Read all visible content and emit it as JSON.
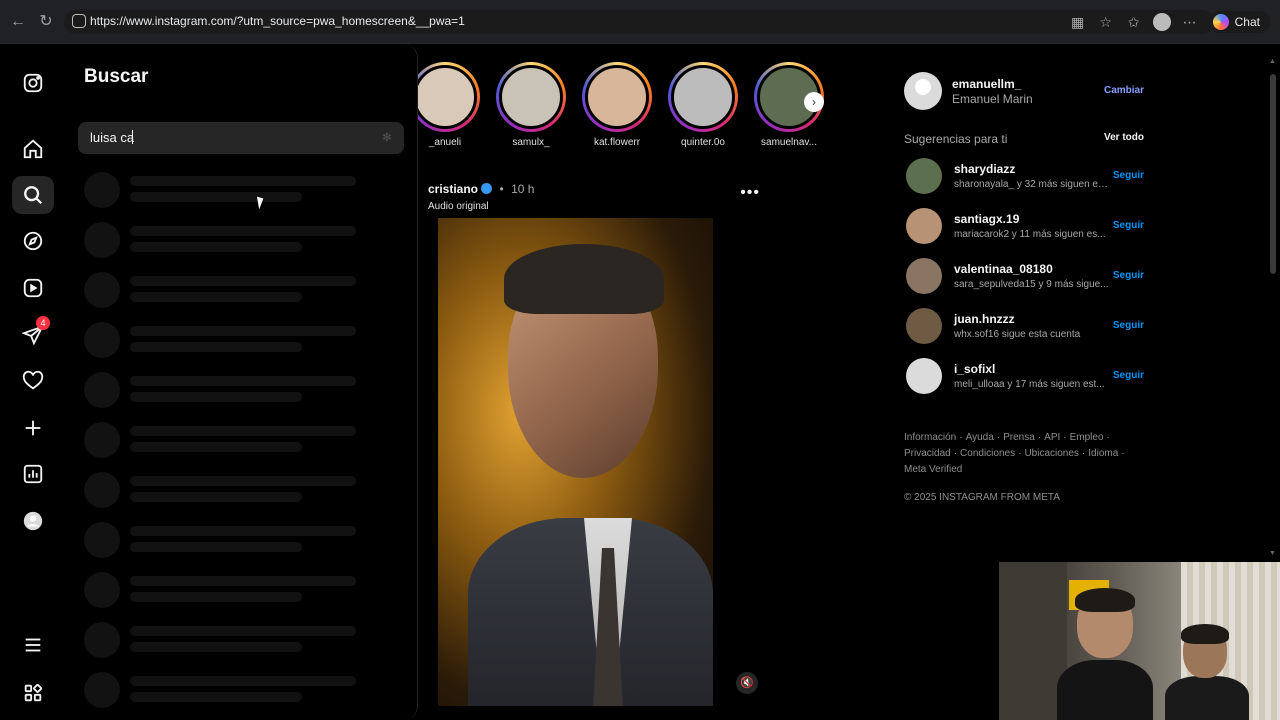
{
  "browser": {
    "url": "https://www.instagram.com/?utm_source=pwa_homescreen&__pwa=1",
    "chat_label": "Chat"
  },
  "rail": {
    "notifications_badge": "4"
  },
  "search": {
    "title": "Buscar",
    "query": "luisa ca"
  },
  "stories": [
    {
      "name": "_anueli",
      "color": "#d9c9b8"
    },
    {
      "name": "samulx_",
      "color": "#c9c2b6"
    },
    {
      "name": "kat.flowerr",
      "color": "#d8b69a"
    },
    {
      "name": "quinter.0o",
      "color": "#bcbcbc"
    },
    {
      "name": "samuelnav...",
      "color": "#5e6d52"
    }
  ],
  "post": {
    "user": "cristiano",
    "time": "10 h",
    "separator": "•",
    "audio": "Audio original"
  },
  "account": {
    "username": "emanuellm_",
    "full_name": "Emanuel Marin",
    "switch_label": "Cambiar"
  },
  "suggestions": {
    "title": "Sugerencias para ti",
    "see_all": "Ver todo",
    "follow_label": "Seguir",
    "items": [
      {
        "user": "sharydiazz",
        "sub": "sharonayala_ y 32 más siguen es...",
        "color": "#5c6f4e"
      },
      {
        "user": "santiagx.19",
        "sub": "mariacarok2 y 11 más siguen es...",
        "color": "#b89274"
      },
      {
        "user": "valentinaa_08180",
        "sub": "sara_sepulveda15 y 9 más sigue...",
        "color": "#8a7462"
      },
      {
        "user": "juan.hnzzz",
        "sub": "whx.sof16 sigue esta cuenta",
        "color": "#6f5a44"
      },
      {
        "user": "i_sofixl",
        "sub": "meli_ulloaa y 17 más siguen est...",
        "color": "#dbdbdb"
      }
    ]
  },
  "footer": {
    "links": [
      "Información",
      "Ayuda",
      "Prensa",
      "API",
      "Empleo",
      "Privacidad",
      "Condiciones",
      "Ubicaciones",
      "Idioma",
      "Meta Verified"
    ],
    "copyright": "© 2025 INSTAGRAM FROM META"
  }
}
